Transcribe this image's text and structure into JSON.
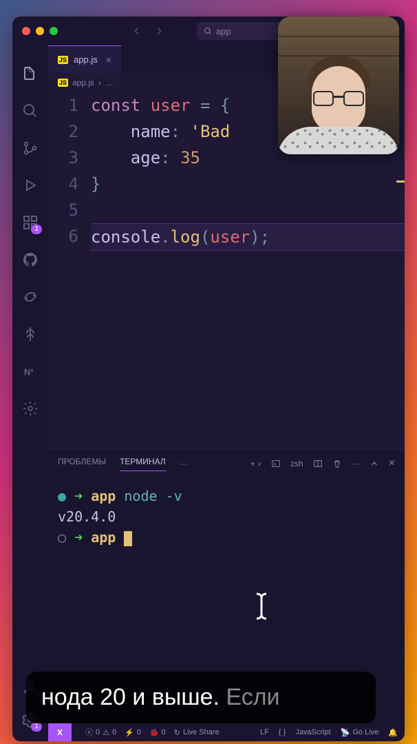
{
  "titlebar": {
    "search_text": "app"
  },
  "activity": {
    "ext_badge": "1"
  },
  "tabs": {
    "file": "app.js"
  },
  "breadcrumb": {
    "file": "app.js",
    "sep": "›",
    "more": "…"
  },
  "editor": {
    "lines": [
      "1",
      "2",
      "3",
      "4",
      "5",
      "6"
    ],
    "l1_kw": "const ",
    "l1_var": "user",
    "l1_rest": " = {",
    "l2_indent": "    ",
    "l2_prop": "name",
    "l2_punc": ": ",
    "l2_str": "'Bad",
    "l3_indent": "    ",
    "l3_prop": "age",
    "l3_punc": ": ",
    "l3_num": "35",
    "l4": "}",
    "l6_obj": "console",
    "l6_dot": ".",
    "l6_fn": "log",
    "l6_open": "(",
    "l6_arg": "user",
    "l6_close": ")",
    "l6_semi": ";"
  },
  "panel": {
    "tab_problems": "ПРОБЛЕМЫ",
    "tab_terminal": "ТЕРМИНАЛ",
    "shell": "zsh"
  },
  "terminal": {
    "l1_dir": "app",
    "l1_cmd": "node -v",
    "l2_out": "v20.4.0",
    "l3_dir": "app"
  },
  "status": {
    "errors": "0",
    "warnings": "0",
    "ports": "0",
    "debug": "0",
    "liveshare": "Live Share",
    "eol": "LF",
    "bracket": "{ }",
    "lang": "JavaScript",
    "golive": "Go Live"
  },
  "caption": {
    "bright": "нода 20 и выше. ",
    "dim": "Если"
  }
}
